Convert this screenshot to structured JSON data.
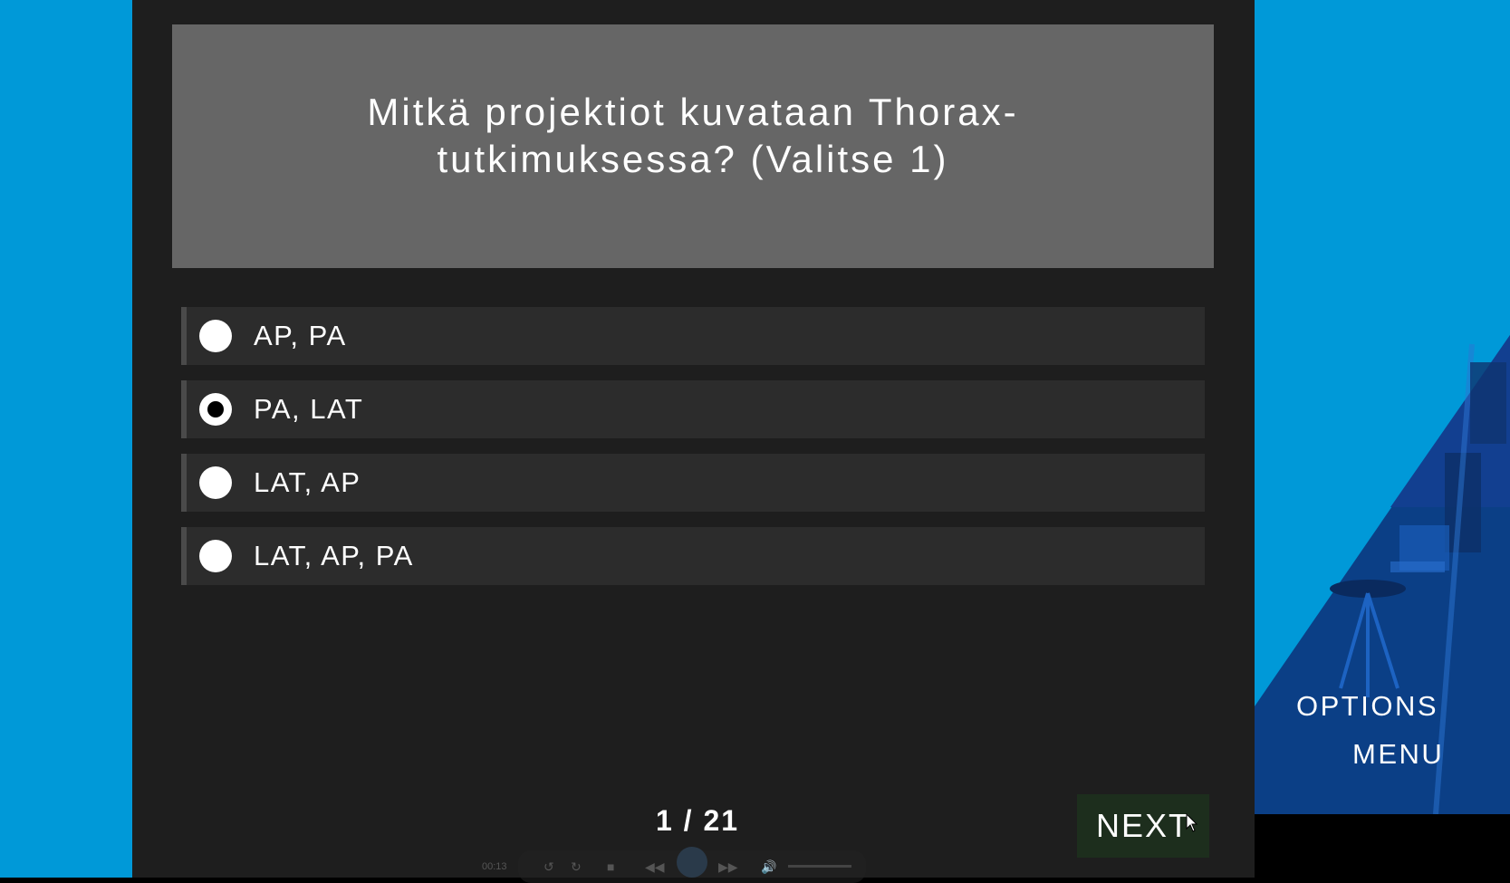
{
  "question": {
    "text": "Mitkä projektiot kuvataan Thorax-tutkimuksessa?  (Valitse 1)"
  },
  "options": [
    {
      "label": "AP, PA",
      "selected": false
    },
    {
      "label": "PA, LAT",
      "selected": true
    },
    {
      "label": "LAT, AP",
      "selected": false
    },
    {
      "label": "LAT, AP, PA",
      "selected": false
    }
  ],
  "progress": {
    "current": 1,
    "total": 21,
    "text": "1 / 21"
  },
  "next_button": {
    "label": "NEXT"
  },
  "side_menu": {
    "options_label": "OPTIONS",
    "menu_label": "MENU"
  },
  "player": {
    "time": "00:13"
  },
  "colors": {
    "accent": "#0099d8",
    "panel": "#1e1e1e",
    "question_bg": "#666666",
    "option_bg": "#2c2c2c"
  }
}
